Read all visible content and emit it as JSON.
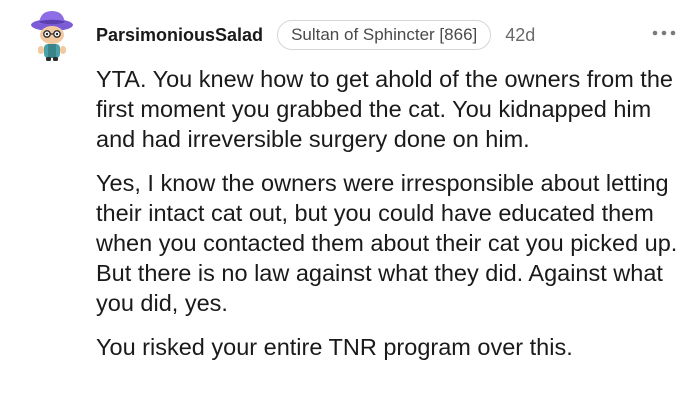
{
  "comment": {
    "author": "ParsimoniousSalad",
    "flair": "Sultan of Sphincter [866]",
    "age": "42d",
    "avatar_icon": "snoo-avatar-purple-hat-icon",
    "more_icon": "more-options-icon",
    "paragraphs": [
      "YTA. You knew how to get ahold of the owners from the first moment you grabbed the cat. You kidnapped him and had irreversible surgery done on him.",
      "Yes, I know the owners were irresponsible about letting their intact cat out, but you could have educated them when you contacted them about their cat you picked up. But there is no law against what they did. Against what you did, yes.",
      "You risked your entire TNR program over this."
    ]
  },
  "colors": {
    "text": "#1a1a1b",
    "muted": "#6a6a6a",
    "flair_border": "#d6d6d6",
    "hat": "#7b5bd6",
    "avatar_face": "#f2c9a0"
  }
}
